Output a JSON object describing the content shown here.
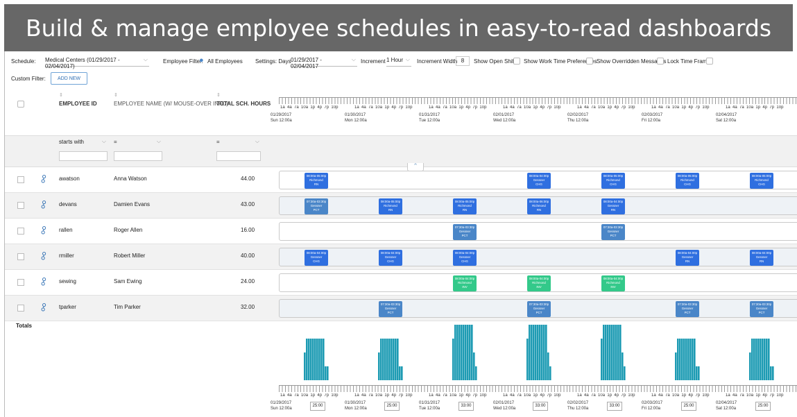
{
  "banner": "Build & manage employee schedules in easy-to-read dashboards",
  "toolbar": {
    "schedule_label": "Schedule:",
    "schedule_value": "Medical Centers (01/29/2017 - 02/04/2017)",
    "employee_filter_label": "Employee Filter:",
    "employee_filter_value": "All Employees",
    "settings_label": "Settings: Days",
    "days_value": "01/29/2017 - 02/04/2017",
    "increment_label": "Increment",
    "increment_value": "1 Hour",
    "increment_width_label": "Increment Width",
    "increment_width_value": "8",
    "show_open_shifts": "Show Open Shifts",
    "show_work_time_prefs": "Show Work Time Preferences",
    "show_overridden": "Show Overridden Messages",
    "lock_time_frame": "Lock Time Frame",
    "custom_filter_label": "Custom Filter:",
    "add_new": "ADD NEW"
  },
  "columns": {
    "employee_id": "EMPLOYEE ID",
    "employee_name": "EMPLOYEE NAME (W/ MOUSE-OVER INFO)",
    "total_hours": "TOTAL SCH. HOURS"
  },
  "filters": {
    "id_op": "starts with",
    "name_op": "=",
    "hours_op": "="
  },
  "tick_labels": "1a  4a  7a  10a  1p  4p  7p  10p",
  "days": [
    {
      "date": "01/29/2017",
      "label": "Sun 12:00a"
    },
    {
      "date": "01/30/2017",
      "label": "Mon 12:00a"
    },
    {
      "date": "01/31/2017",
      "label": "Tue 12:00a"
    },
    {
      "date": "02/01/2017",
      "label": "Wed 12:00a"
    },
    {
      "date": "02/02/2017",
      "label": "Thu 12:00a"
    },
    {
      "date": "02/03/2017",
      "label": "Fri 12:00a"
    },
    {
      "date": "02/04/2017",
      "label": "Sat 12:00a"
    }
  ],
  "colors": {
    "blue": "#2f6fe0",
    "steel": "#4a86c8",
    "green": "#33c98a",
    "bar": "#1d9bb3"
  },
  "employees": [
    {
      "id": "awatson",
      "name": "Anna Watson",
      "hours": "44.00",
      "shifts": [
        {
          "day": 0,
          "time": "08:00a-05:00p",
          "loc": "Richmond",
          "role": "RN",
          "color": "blue"
        },
        {
          "day": 3,
          "time": "08:00a-04:00p",
          "loc": "Gessner",
          "role": "CHG",
          "color": "blue"
        },
        {
          "day": 4,
          "time": "08:00a-05:00p",
          "loc": "Richmond",
          "role": "CHG",
          "color": "blue"
        },
        {
          "day": 5,
          "time": "08:00a-05:00p",
          "loc": "Richmond",
          "role": "CHG",
          "color": "blue"
        },
        {
          "day": 6,
          "time": "08:00a-05:00p",
          "loc": "Richmond",
          "role": "CHG",
          "color": "blue"
        }
      ]
    },
    {
      "id": "devans",
      "name": "Damien Evans",
      "hours": "43.00",
      "shifts": [
        {
          "day": 0,
          "time": "07:30a-03:30p",
          "loc": "Gessner",
          "role": "PCT",
          "color": "steel"
        },
        {
          "day": 1,
          "time": "08:00a-05:00p",
          "loc": "Richmond",
          "role": "RN",
          "color": "blue"
        },
        {
          "day": 2,
          "time": "08:00a-05:00p",
          "loc": "Richmond",
          "role": "RN",
          "color": "blue"
        },
        {
          "day": 3,
          "time": "08:00a-06:00p",
          "loc": "Richmond",
          "role": "RN",
          "color": "blue"
        },
        {
          "day": 4,
          "time": "08:00a-04:00p",
          "loc": "Gessner",
          "role": "RN",
          "color": "blue"
        }
      ]
    },
    {
      "id": "rallen",
      "name": "Roger Allen",
      "hours": "16.00",
      "shifts": [
        {
          "day": 2,
          "time": "07:30a-03:30p",
          "loc": "Gessner",
          "role": "PCT",
          "color": "steel"
        },
        {
          "day": 4,
          "time": "07:30a-03:30p",
          "loc": "Gessner",
          "role": "PCT",
          "color": "steel"
        }
      ]
    },
    {
      "id": "rmiller",
      "name": "Robert Miller",
      "hours": "40.00",
      "shifts": [
        {
          "day": 0,
          "time": "08:00a-04:00p",
          "loc": "Gessner",
          "role": "CHG",
          "color": "blue"
        },
        {
          "day": 1,
          "time": "08:00a-04:00p",
          "loc": "Gessner",
          "role": "CHG",
          "color": "blue"
        },
        {
          "day": 2,
          "time": "08:00a-04:00p",
          "loc": "Gessner",
          "role": "CHG",
          "color": "blue"
        },
        {
          "day": 5,
          "time": "08:00a-04:00p",
          "loc": "Gessner",
          "role": "RN",
          "color": "blue"
        },
        {
          "day": 6,
          "time": "08:00a-04:00p",
          "loc": "Gessner",
          "role": "RN",
          "color": "blue"
        }
      ]
    },
    {
      "id": "sewing",
      "name": "Sam Ewing",
      "hours": "24.00",
      "shifts": [
        {
          "day": 2,
          "time": "08:00a-04:00p",
          "loc": "Richmond",
          "role": "INV",
          "color": "green"
        },
        {
          "day": 3,
          "time": "08:00a-04:00p",
          "loc": "Richmond",
          "role": "INV",
          "color": "green"
        },
        {
          "day": 4,
          "time": "08:00a-04:00p",
          "loc": "Richmond",
          "role": "INV",
          "color": "green"
        }
      ]
    },
    {
      "id": "tparker",
      "name": "Tim Parker",
      "hours": "32.00",
      "shifts": [
        {
          "day": 1,
          "time": "07:30a-03:30p",
          "loc": "Gessner",
          "role": "PCT",
          "color": "steel"
        },
        {
          "day": 3,
          "time": "07:30a-03:30p",
          "loc": "Gessner",
          "role": "PCT",
          "color": "steel"
        },
        {
          "day": 5,
          "time": "07:30a-03:30p",
          "loc": "Gessner",
          "role": "PCT",
          "color": "steel"
        },
        {
          "day": 6,
          "time": "07:30a-03:30p",
          "loc": "Gessner",
          "role": "PCT",
          "color": "steel"
        }
      ]
    }
  ],
  "totals": {
    "label": "Totals",
    "day_totals": [
      "25:00",
      "25:00",
      "33:00",
      "33:00",
      "33:00",
      "25:00",
      "25:00"
    ],
    "peak_heads": [
      3,
      3,
      4,
      4,
      4,
      3,
      3
    ]
  }
}
